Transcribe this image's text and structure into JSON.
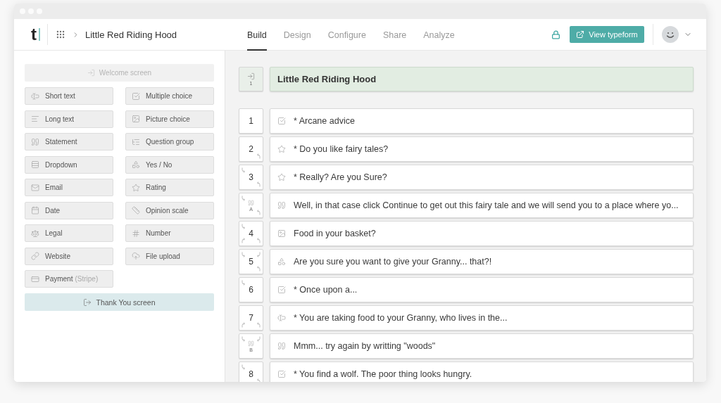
{
  "header": {
    "logo": "t",
    "form_name": "Little Red Riding Hood",
    "tabs": [
      {
        "label": "Build",
        "selected": true
      },
      {
        "label": "Design",
        "selected": false
      },
      {
        "label": "Configure",
        "selected": false
      },
      {
        "label": "Share",
        "selected": false
      },
      {
        "label": "Analyze",
        "selected": false
      }
    ],
    "view_button": "View typeform"
  },
  "palette": {
    "welcome": {
      "label": "Welcome screen",
      "disabled": true
    },
    "items": [
      {
        "kind": "short_text",
        "label": "Short text"
      },
      {
        "kind": "multiple_choice",
        "label": "Multiple choice"
      },
      {
        "kind": "long_text",
        "label": "Long text"
      },
      {
        "kind": "picture_choice",
        "label": "Picture choice"
      },
      {
        "kind": "statement",
        "label": "Statement"
      },
      {
        "kind": "question_group",
        "label": "Question group"
      },
      {
        "kind": "dropdown",
        "label": "Dropdown"
      },
      {
        "kind": "yes_no",
        "label": "Yes / No"
      },
      {
        "kind": "email",
        "label": "Email"
      },
      {
        "kind": "rating",
        "label": "Rating"
      },
      {
        "kind": "date",
        "label": "Date"
      },
      {
        "kind": "opinion_scale",
        "label": "Opinion scale"
      },
      {
        "kind": "legal",
        "label": "Legal"
      },
      {
        "kind": "number",
        "label": "Number"
      },
      {
        "kind": "website",
        "label": "Website"
      },
      {
        "kind": "file_upload",
        "label": "File upload"
      },
      {
        "kind": "payment",
        "label": "Payment",
        "note": "(Stripe)"
      }
    ],
    "thank_you": {
      "label": "Thank You screen"
    }
  },
  "outline": {
    "title_card": {
      "number": "1",
      "title": "Little Red Riding Hood"
    },
    "rows": [
      {
        "kind": "multiple_choice",
        "label": "1",
        "text": "* Arcane advice",
        "arrows": {
          "top_left": false,
          "top_right": false,
          "bottom_left": false,
          "bottom_right": false
        }
      },
      {
        "kind": "rating",
        "label": "2",
        "text": "* Do you like fairy tales?",
        "arrows": {
          "top_left": false,
          "top_right": false,
          "bottom_left": false,
          "bottom_right": true
        }
      },
      {
        "kind": "rating",
        "label": "3",
        "text": "* Really? Are you Sure?",
        "arrows": {
          "top_left": true,
          "top_right": false,
          "bottom_left": false,
          "bottom_right": true
        }
      },
      {
        "kind": "statement",
        "label": "A",
        "text": "Well, in that case click Continue to get out this fairy tale and we will send you to a place where yo...",
        "arrows": {
          "top_left": true,
          "top_right": false,
          "bottom_left": false,
          "bottom_right": true
        }
      },
      {
        "kind": "picture_choice",
        "label": "4",
        "text": "Food in your basket?",
        "arrows": {
          "top_left": true,
          "top_right": false,
          "bottom_left": true,
          "bottom_right": true
        }
      },
      {
        "kind": "yes_no",
        "label": "5",
        "text": "Are you sure you want to give your Granny... that?!",
        "arrows": {
          "top_left": true,
          "top_right": true,
          "bottom_left": false,
          "bottom_right": true
        }
      },
      {
        "kind": "multiple_choice",
        "label": "6",
        "text": "* Once upon a...",
        "arrows": {
          "top_left": true,
          "top_right": false,
          "bottom_left": false,
          "bottom_right": false
        }
      },
      {
        "kind": "short_text",
        "label": "7",
        "text": "* You are taking food to your Granny, who lives in the...",
        "arrows": {
          "top_left": false,
          "top_right": false,
          "bottom_left": true,
          "bottom_right": true
        }
      },
      {
        "kind": "statement",
        "label": "B",
        "text": "Mmm... try again by writting \"woods\"",
        "arrows": {
          "top_left": true,
          "top_right": true,
          "bottom_left": false,
          "bottom_right": false
        }
      },
      {
        "kind": "multiple_choice",
        "label": "8",
        "text": "* You find a wolf. The poor thing looks hungry.",
        "arrows": {
          "top_left": true,
          "top_right": false,
          "bottom_left": false,
          "bottom_right": true
        }
      }
    ]
  }
}
